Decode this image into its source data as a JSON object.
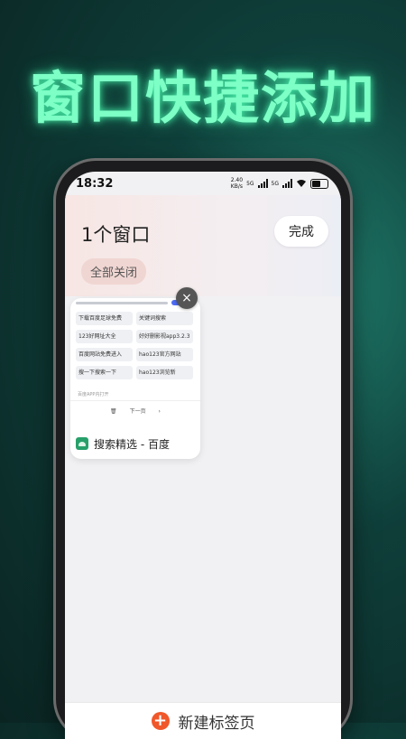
{
  "headline": "窗口快捷添加",
  "status": {
    "time": "18:32",
    "net_speed": "2.40",
    "net_unit": "KB/s",
    "sim1": "5G",
    "sim2": "5G"
  },
  "window_panel": {
    "title": "1个窗口",
    "done_label": "完成",
    "close_all_label": "全部关闭"
  },
  "tab": {
    "title": "搜索精选 - 百度",
    "preview_links": [
      "下载百度足球免费",
      "关键词搜索",
      "123好网址大全",
      "好好删影视app3.2.3",
      "百度网站免费进入",
      "hao123官方网站",
      "搜一下搜索一下",
      "hao123浏览新"
    ],
    "open_app_hint": "百度APP内打开",
    "pager_next": "下一页",
    "close_icon": "×"
  },
  "bottom": {
    "new_tab_label": "新建标签页",
    "plus_icon": "+"
  },
  "colors": {
    "headline_glow": "#7dffc6",
    "accent": "#f0572a",
    "search_button": "#4e6cf5"
  }
}
